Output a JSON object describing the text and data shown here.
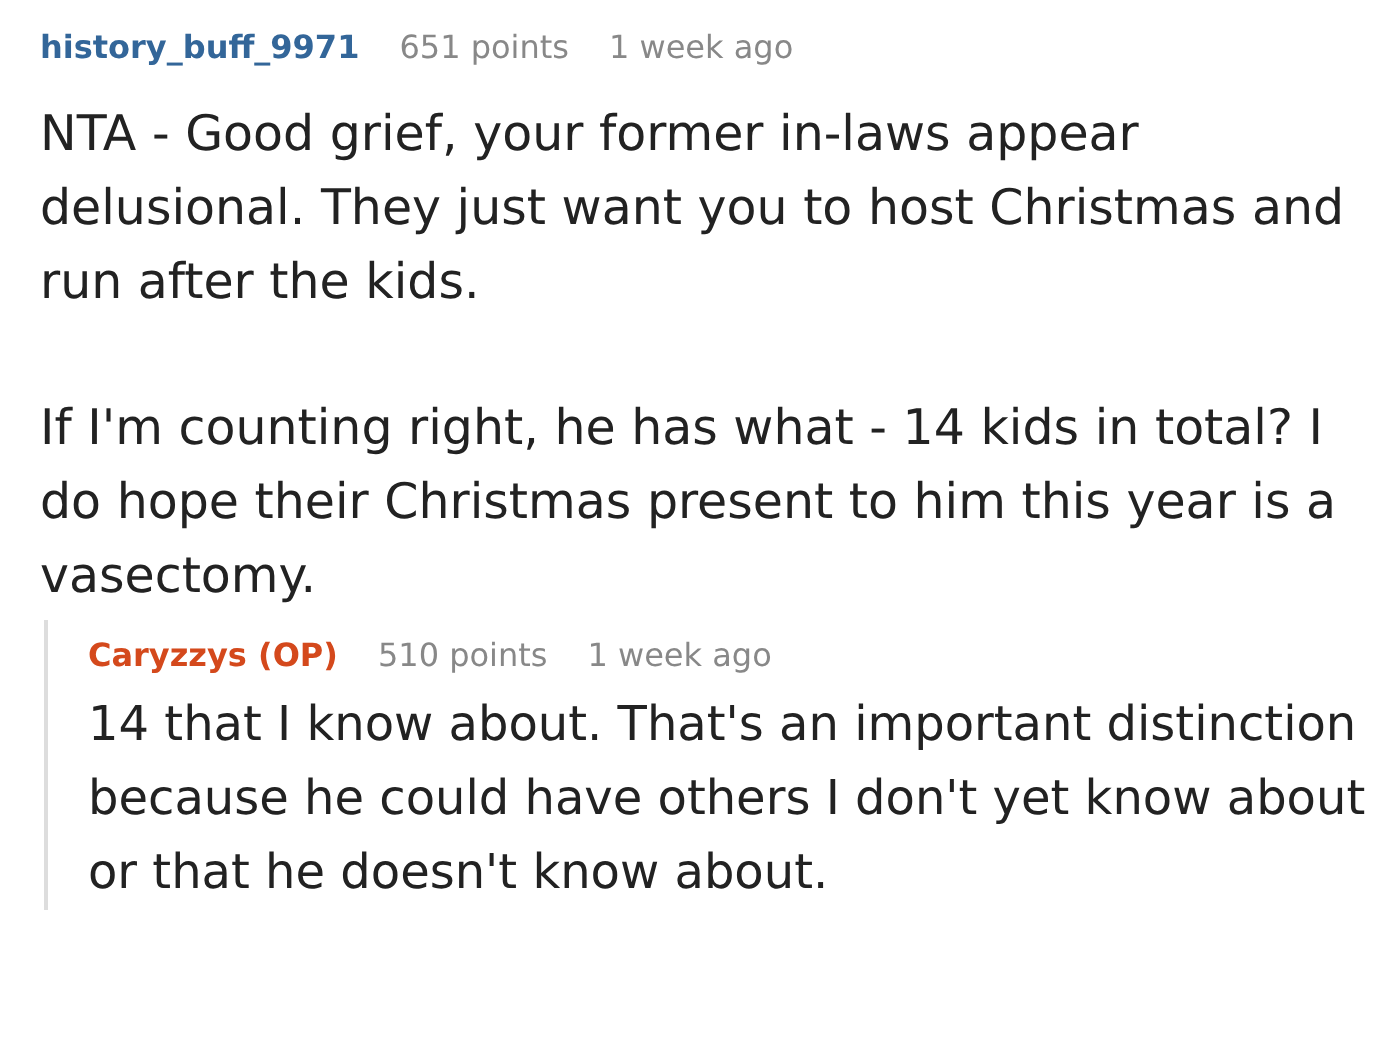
{
  "comments": [
    {
      "author": "history_buff_9971",
      "is_op": false,
      "points": "651 points",
      "time": "1 week ago",
      "paragraphs": [
        "NTA - Good grief, your former in-laws appear delusional. They just want you to host Christmas and run after the kids.",
        "If I'm counting right, he has what - 14 kids in total? I do hope their Christmas present to him this year is a vasectomy."
      ],
      "children": [
        {
          "author": "Caryzzys (OP)",
          "is_op": true,
          "points": "510 points",
          "time": "1 week ago",
          "paragraphs": [
            "14 that I know about. That's an important distinction because he could have others I don't yet know about or that he doesn't know about."
          ]
        }
      ]
    }
  ]
}
